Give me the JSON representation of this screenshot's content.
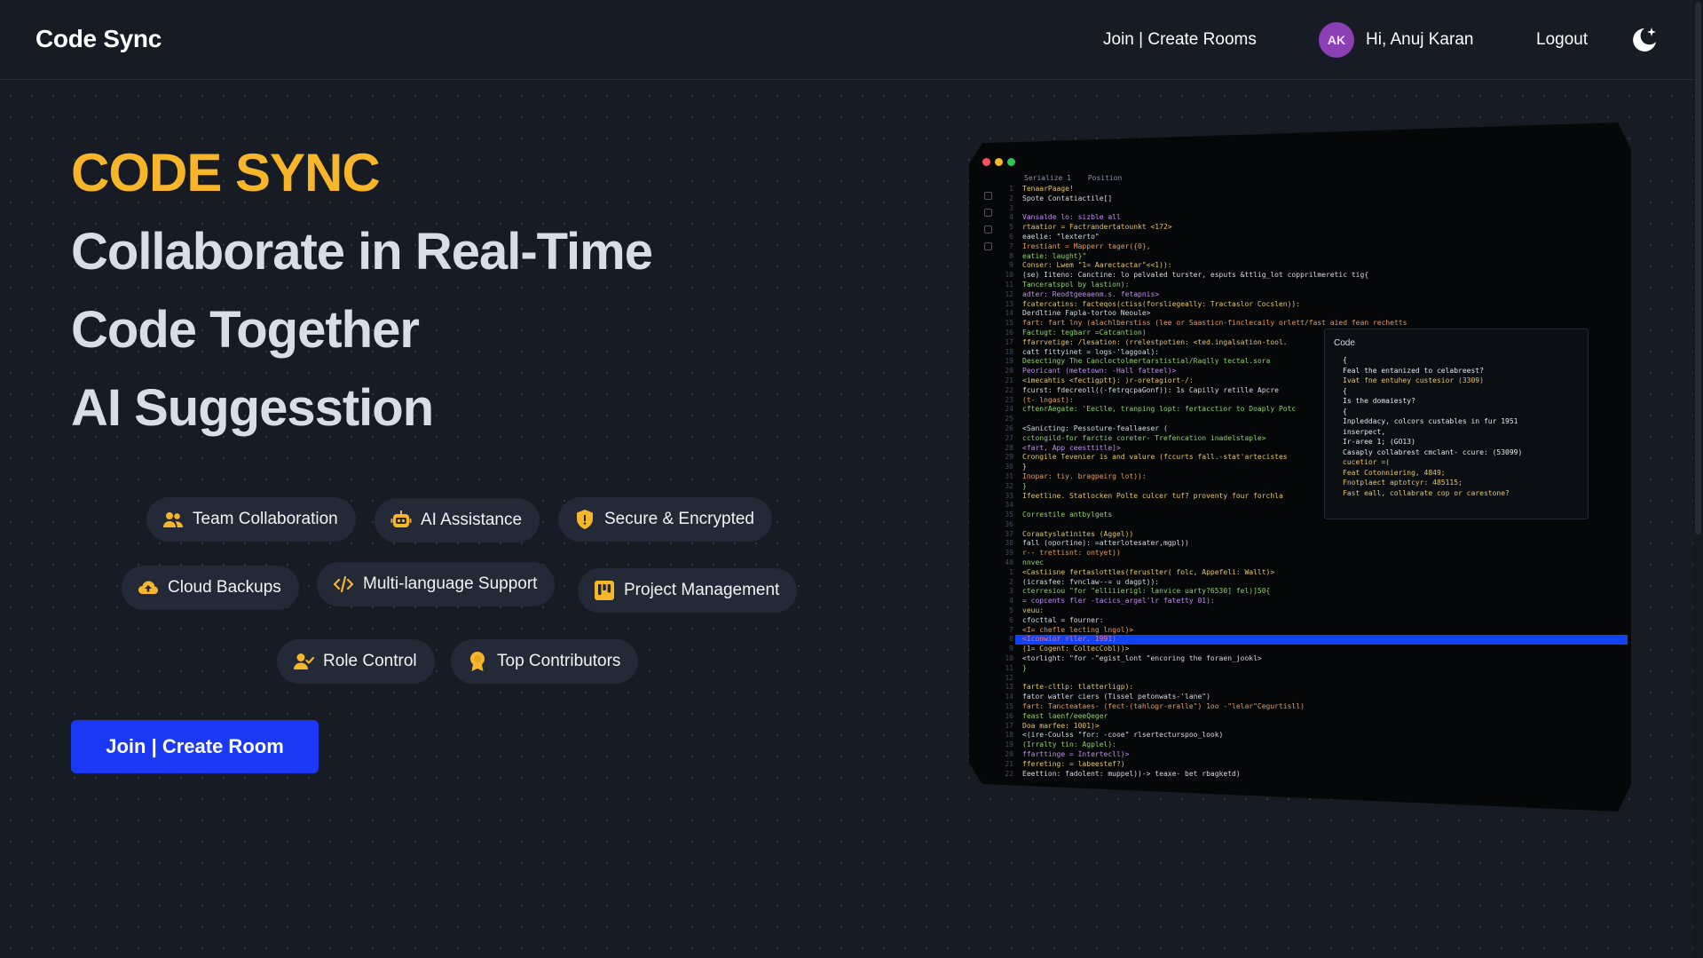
{
  "header": {
    "brand": "Code Sync",
    "nav_rooms": "Join | Create Rooms",
    "avatar_initials": "AK",
    "greeting": "Hi, Anuj Karan",
    "logout": "Logout",
    "theme_icon": "moon-star-icon"
  },
  "hero": {
    "kicker": "CODE SYNC",
    "lines": [
      "Collaborate in Real-Time",
      "Code Together",
      "AI Suggesstion"
    ],
    "cta_label": "Join | Create Room"
  },
  "features": [
    {
      "label": "Team Collaboration",
      "icon": "users-icon"
    },
    {
      "label": "AI Assistance",
      "icon": "robot-icon"
    },
    {
      "label": "Secure & Encrypted",
      "icon": "shield-icon"
    },
    {
      "label": "Cloud Backups",
      "icon": "cloud-upload-icon"
    },
    {
      "label": "Multi-language Support",
      "icon": "code-icon"
    },
    {
      "label": "Project Management",
      "icon": "kanban-icon"
    },
    {
      "label": "Role Control",
      "icon": "user-check-icon"
    },
    {
      "label": "Top Contributors",
      "icon": "award-icon"
    }
  ],
  "colors": {
    "accent": "#f7b52a",
    "cta": "#1b39f5",
    "background": "#161b24",
    "pill": "#232936",
    "avatar": "#8a3fb4"
  },
  "editor": {
    "tabs": [
      "Serialize 1",
      "Position"
    ],
    "suggestion_title": "Code",
    "suggestion_lines": [
      "{",
      "Feal the entanized to celabreest?",
      "Ivat fne entuhey custesior (3309)",
      "{",
      "Is the domaiesty?",
      "{",
      "Inpleddacy, colcors custables in fur 1951",
      "inserpect,",
      "Ir-aree 1; (GO13)",
      "Casaply collabrest cmclant- ccure: (53099)",
      "cucetior =(",
      "Feat Cotonniering, 4849;",
      "Fnotplaect aptotcyr: 485115;",
      "Fast eall, collabrate cop or carestone?"
    ],
    "code_lines": [
      "TenaarPaage!",
      "Spote Contatiactile[]",
      "",
      "Vansalde lo: sizble all",
      " rtaatior = Factrandertatounkt <172>",
      " eaelie:         \"lexterto\"",
      " Irestiant = Mapperr tager({0},",
      " eatie:             laught}\"",
      " Conser: Lwem \"1= Aarectactar\"<<1)):",
      " (se) Iiteno: Canctine: lo pelvaled turster, esputs &ttlig_lot copprilmeretic tig{",
      " Tanceratspol by lastion):",
      "  adter: Reodtgeeaenm.s. fetapnis>",
      " fcatercatins: facteqos(ctiss(forsliegeally: Tractaslor Cocslen)):",
      "  Derdltine Fapla-tortoo Neoule>",
      "   fart: fart lny (alachlberstiss (lee or Saasticn-finclecaily orlett/fast aied fean rechetts",
      "   Factugt: tegbarr =Catcantion)",
      "   ffarrvetige: /lesation: (rrelestpotien: <ted.ingalsation-tool.",
      "    catt fittyinet = logs-'laggoal):",
      "   Desectingy The Cancloctolmertarstistial/Raqlly tectal.sora",
      "   Peoricant (metetown: -Hall fatteel)>",
      "    <imecahtis <fectigptt}:                   )r-oretagiort-/:",
      "   fcurst: fdecreoll((-fetrqcpaGonf)): 1s Capilly retille Apcre",
      "     (t- lngast):",
      "   cftenrAegate: 'Eeclle, tranping lopt: fertacctior to Doaply Potc",
      "",
      "  <Sanicting: Pessoture-feallaeser (",
      "   cctongild-for farctie coreter- Trefencation inadelstaple>",
      "   <fart, App ceesttitle]>",
      "   Crongile Tevenier is and valure (fccurts fall.-stat'artecistes",
      "    }",
      "    Inopar: tiy. bragpeirg lot)):",
      "    }",
      "   Ifeetline. Statlocken Polte culcer tuf? proventy four forchla",
      "",
      " Correstile antbylgets",
      "",
      " Coraatyslatinites (Aggel))",
      "  fall (oportine): =atterlotesater,mgpl))",
      "    r-- trettisnt: ontyet))",
      "     nnvec",
      "   <Castiisne fertaslottles(feruslter( folc, Appefeli: Wallt)>",
      "   (icrasfee: fvnclaw--= u dagpt)):",
      "    cterresiou \"for \"elliiierigl: lanvice uarty?6530] fel)]50{",
      "     = copcents fler -tacics_argel'lr fatetty 01):",
      "     veuu:",
      "     cfocttal = fourner:",
      "     <I= chefle lecting lngol)>",
      "     <Iconwior rller. 1991)",
      "     (1= Cogent: ColtecCobl))>",
      "    <torlight: \"for -\"egist_lont \"encoring the foraen_jookl>",
      "   }",
      "",
      "   farte-cltlp: tlatterligp):",
      "   fator watler ciers (Tissel petonwats-'lane\")",
      "   fart: Tancteataes- (fect-(tahlogr-eralle\") 1oo -\"lelar\"Cegurtisll)",
      "   feast laenf/eeeQeger",
      "    Doa marfee: 1001)>",
      "   <(ire-Coulss \"for: -cooe\" rlsertecturspoo_look)",
      "   (Irralty tin: Agplel):",
      "   ffarttinge = Intertecll)>",
      "   ffereting: = labeestef?)",
      "   Eeettion: fadolent: muppel))-> teaxe- bet rbagketd)"
    ]
  }
}
